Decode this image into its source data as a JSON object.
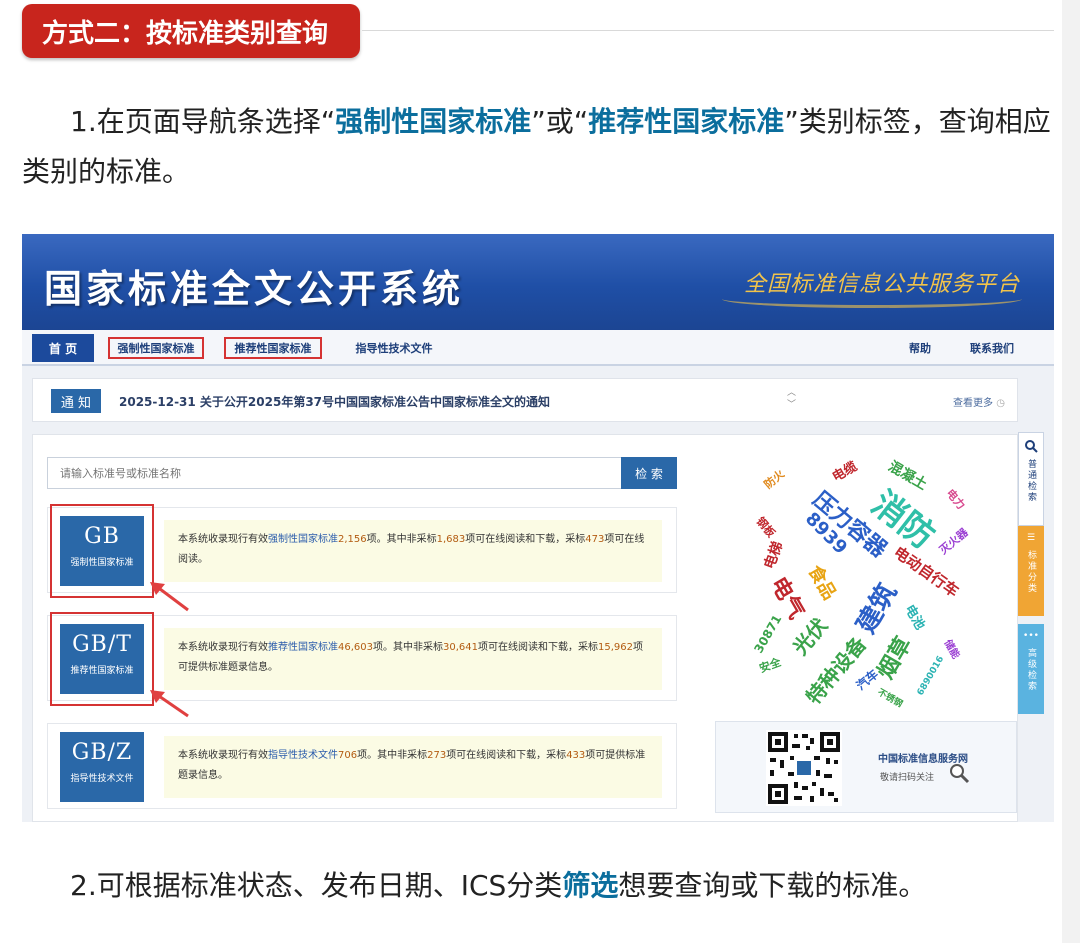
{
  "section": {
    "badge": "方式二：按标准类别查询"
  },
  "para1": {
    "pre": "1.在页面导航条选择“",
    "hl1": "强制性国家标准",
    "mid": "”或“",
    "hl2": "推荐性国家标准",
    "post": "”类别标签，查询相应类别的标准。"
  },
  "para2": {
    "pre": "2.可根据标准状态、发布日期、ICS分类",
    "hl": "筛选",
    "post": "想要查询或下载的标准。"
  },
  "site": {
    "title": "国家标准全文公开系统",
    "slogan": "全国标准信息公共服务平台",
    "nav": {
      "home": "首 页",
      "mandatory": "强制性国家标准",
      "recommended": "推荐性国家标准",
      "guidance": "指导性技术文件",
      "help": "帮助",
      "contact": "联系我们"
    },
    "notice": {
      "tag": "通 知",
      "text": "2025-12-31  关于公开2025年第37号中国国家标准公告中国家标准全文的通知",
      "more": "查看更多"
    },
    "search": {
      "placeholder": "请输入标准号或标准名称",
      "button": "检 索"
    },
    "categories": [
      {
        "code": "GB",
        "name": "强制性国家标准",
        "d1": "本系统收录现行有效",
        "type": "强制性国家标准",
        "total": "2,156",
        "d2": "项。其中非采标",
        "nonadopt": "1,683",
        "d3": "项可在线阅读和下载，采标",
        "adopt": "473",
        "d4": "项可在线阅读。"
      },
      {
        "code": "GB/T",
        "name": "推荐性国家标准",
        "d1": "本系统收录现行有效",
        "type": "推荐性国家标准",
        "total": "46,603",
        "d2": "项。其中非采标",
        "nonadopt": "30,641",
        "d3": "项可在线阅读和下载，采标",
        "adopt": "15,962",
        "d4": "项可提供标准题录信息。"
      },
      {
        "code": "GB/Z",
        "name": "指导性技术文件",
        "d1": "本系统收录现行有效",
        "type": "指导性技术文件",
        "total": "706",
        "d2": "项。其中非采标",
        "nonadopt": "273",
        "d3": "项可在线阅读和下载，采标",
        "adopt": "433",
        "d4": "项可提供标准题录信息。"
      }
    ],
    "tags": [
      "防火",
      "电缆",
      "混凝土",
      "压力容器",
      "消防",
      "电力",
      "钢板",
      "8939",
      "灭火器",
      "电梯",
      "食品",
      "电动自行车",
      "电气",
      "建筑",
      "30871",
      "光伏",
      "电池",
      "储能",
      "安全",
      "特种设备",
      "烟草",
      "汽车",
      "6890016",
      "不锈钢"
    ],
    "qr": {
      "title": "中国标准信息服务网",
      "sub": "敬请扫码关注"
    },
    "side": {
      "normal": "普通检索",
      "category": "标准分类",
      "advanced": "高级检索"
    },
    "colors": {
      "nav_blue": "#1c4a9c",
      "highlight_red": "#d53333",
      "accent_teal": "#0b6e9d"
    }
  }
}
